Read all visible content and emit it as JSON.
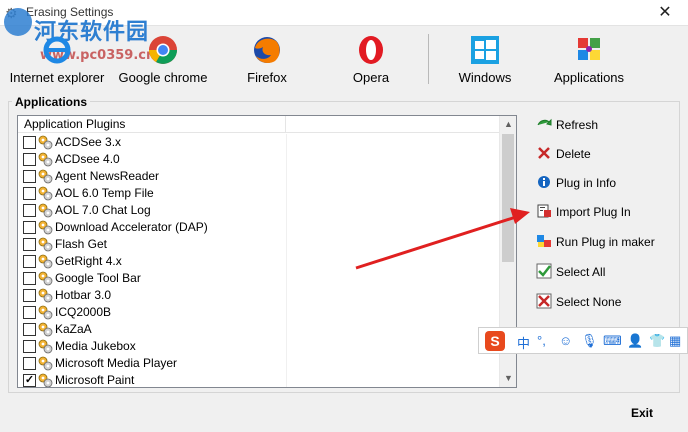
{
  "window": {
    "title": "Erasing Settings",
    "close_glyph": "✕"
  },
  "watermark": {
    "text": "河东软件园",
    "url": "www.pc0359.cn"
  },
  "toolbar": {
    "items": [
      {
        "label": "Internet explorer",
        "icon": "internet-explorer-icon"
      },
      {
        "label": "Google chrome",
        "icon": "chrome-icon"
      },
      {
        "label": "Firefox",
        "icon": "firefox-icon"
      },
      {
        "label": "Opera",
        "icon": "opera-icon"
      },
      {
        "label": "Windows",
        "icon": "windows-icon"
      },
      {
        "label": "Applications",
        "icon": "applications-icon"
      }
    ]
  },
  "applications": {
    "group_label": "Applications",
    "column_header": "Application Plugins",
    "rows": [
      {
        "name": "ACDSee 3.x",
        "checked": false
      },
      {
        "name": "ACDsee 4.0",
        "checked": false
      },
      {
        "name": "Agent NewsReader",
        "checked": false
      },
      {
        "name": "AOL 6.0 Temp File",
        "checked": false
      },
      {
        "name": "AOL 7.0 Chat Log",
        "checked": false
      },
      {
        "name": "Download Accelerator (DAP)",
        "checked": false
      },
      {
        "name": "Flash Get",
        "checked": false
      },
      {
        "name": "GetRight 4.x",
        "checked": false
      },
      {
        "name": "Google Tool Bar",
        "checked": false
      },
      {
        "name": "Hotbar 3.0",
        "checked": false
      },
      {
        "name": "ICQ2000B",
        "checked": false
      },
      {
        "name": "KaZaA",
        "checked": false
      },
      {
        "name": "Media Jukebox",
        "checked": false
      },
      {
        "name": "Microsoft Media Player",
        "checked": false
      },
      {
        "name": "Microsoft Paint",
        "checked": true
      }
    ]
  },
  "actions": [
    {
      "label": "Refresh",
      "icon": "refresh-icon"
    },
    {
      "label": "Delete",
      "icon": "delete-icon"
    },
    {
      "label": "Plug in Info",
      "icon": "info-icon"
    },
    {
      "label": "Import Plug In",
      "icon": "import-icon"
    },
    {
      "label": "Run Plug in maker",
      "icon": "plugin-maker-icon"
    },
    {
      "label": "Select All",
      "icon": "select-all-icon"
    },
    {
      "label": "Select None",
      "icon": "select-none-icon"
    }
  ],
  "footer": {
    "exit_label": "Exit"
  },
  "ime_bar": {
    "logo": "S",
    "mode": "中",
    "punct": "°,"
  },
  "colors": {
    "arrow": "#e02020",
    "accent": "#2e7fd1"
  }
}
